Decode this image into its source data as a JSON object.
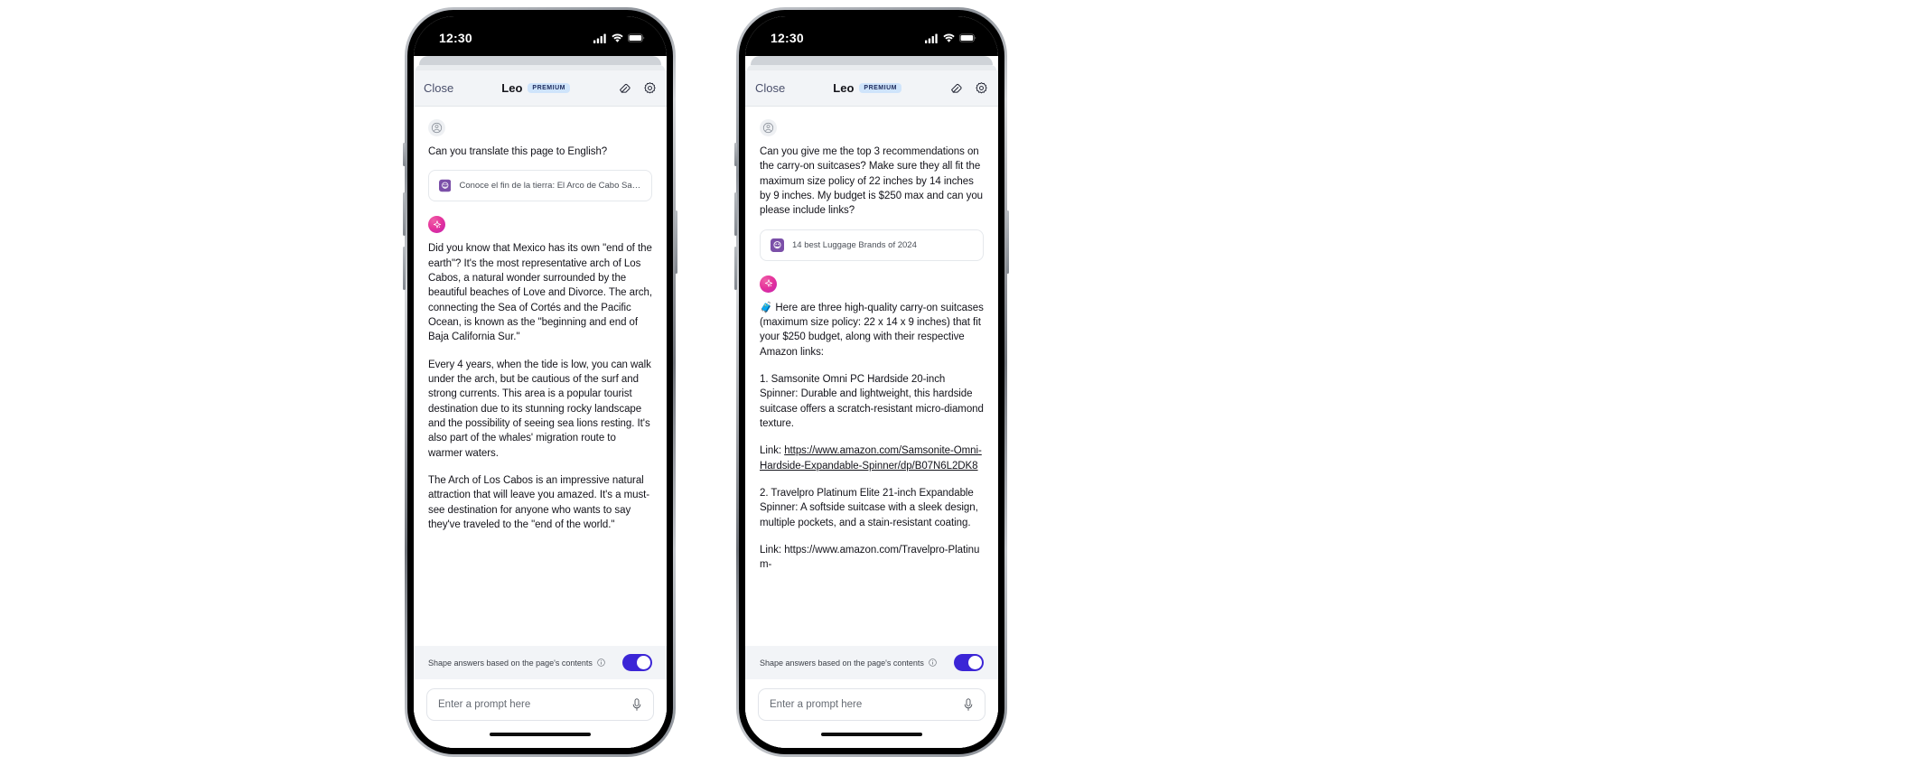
{
  "phones": [
    {
      "id": "phone-left",
      "status_bar": {
        "time": "12:30",
        "cellular_icon": "cellular-bars-icon",
        "wifi_icon": "wifi-icon",
        "battery_icon": "battery-icon"
      },
      "header": {
        "close_label": "Close",
        "title": "Leo",
        "badge": "PREMIUM",
        "eraser_icon": "eraser-icon",
        "settings_icon": "gear-icon"
      },
      "conversation": {
        "user_avatar_icon": "user-avatar-icon",
        "user_message": "Can you translate this page to English?",
        "page_card": {
          "favicon_icon": "page-favicon-icon",
          "title": "Conoce el fin de la tierra: El Arco de Cabo San Lucas"
        },
        "leo_avatar_icon": "leo-sparkle-icon",
        "leo_paragraphs": [
          "Did you know that Mexico has its own \"end of the earth\"? It's the most representative arch of Los Cabos, a natural wonder surrounded by the beautiful beaches of Love and Divorce. The arch, connecting the Sea of Cortés and the Pacific Ocean, is known as the \"beginning and end of Baja California Sur.\"",
          "Every 4 years, when the tide is low, you can walk under the arch, but be cautious of the surf and strong currents. This area is a popular tourist destination due to its stunning rocky landscape and the possibility of seeing sea lions resting. It's also part of the whales' migration route to warmer waters.",
          "The Arch of Los Cabos is an impressive natural attraction that will leave you amazed. It's a must-see destination for anyone who wants to say they've traveled to the \"end of the world.\""
        ]
      },
      "footer": {
        "shape_label": "Shape answers based on the page's contents",
        "info_icon": "info-icon",
        "toggle_state": "on",
        "prompt_placeholder": "Enter a prompt here",
        "mic_icon": "microphone-icon"
      }
    },
    {
      "id": "phone-right",
      "status_bar": {
        "time": "12:30",
        "cellular_icon": "cellular-bars-icon",
        "wifi_icon": "wifi-icon",
        "battery_icon": "battery-icon"
      },
      "header": {
        "close_label": "Close",
        "title": "Leo",
        "badge": "PREMIUM",
        "eraser_icon": "eraser-icon",
        "settings_icon": "gear-icon"
      },
      "conversation": {
        "user_avatar_icon": "user-avatar-icon",
        "user_message": "Can you give me the top 3 recommendations on the carry-on suitcases? Make sure they all fit the maximum size policy of 22 inches by 14 inches by 9 inches. My budget is $250 max and can you please include links?",
        "page_card": {
          "favicon_icon": "page-favicon-icon",
          "title": "14 best Luggage Brands of 2024"
        },
        "leo_avatar_icon": "leo-sparkle-icon",
        "leo_intro": "🧳 Here are three high-quality carry-on suitcases (maximum size policy: 22 x 14 x 9 inches) that fit your $250 budget, along with their respective Amazon links:",
        "leo_item_1": "1. Samsonite Omni PC Hardside 20-inch Spinner: Durable and lightweight, this hardside suitcase offers a scratch-resistant micro-diamond texture.",
        "leo_link_1_prefix": "Link: ",
        "leo_link_1_url": "https://www.amazon.com/Samsonite-Omni-Hardside-Expandable-Spinner/dp/B07N6L2DK8",
        "leo_item_2": "2. Travelpro Platinum Elite 21-inch Expandable Spinner: A softside suitcase with a sleek design, multiple pockets, and a stain-resistant coating.",
        "leo_link_2_prefix": "Link: ",
        "leo_link_2_url": "https://www.amazon.com/Travelpro-Platinum-"
      },
      "footer": {
        "shape_label": "Shape answers based on the page's contents",
        "info_icon": "info-icon",
        "toggle_state": "on",
        "prompt_placeholder": "Enter a prompt here",
        "mic_icon": "microphone-icon"
      }
    }
  ],
  "colors": {
    "premium_badge_bg": "#cfe4fb",
    "premium_badge_text": "#1d2a5c",
    "toggle_on": "#3b25d6",
    "close_text": "#4a4f6b",
    "header_bg": "#f2f4f7",
    "leo_avatar_gradient_from": "#ef5ea8",
    "leo_avatar_gradient_to": "#c21fb2",
    "favicon_purple": "#7b4fa8"
  }
}
